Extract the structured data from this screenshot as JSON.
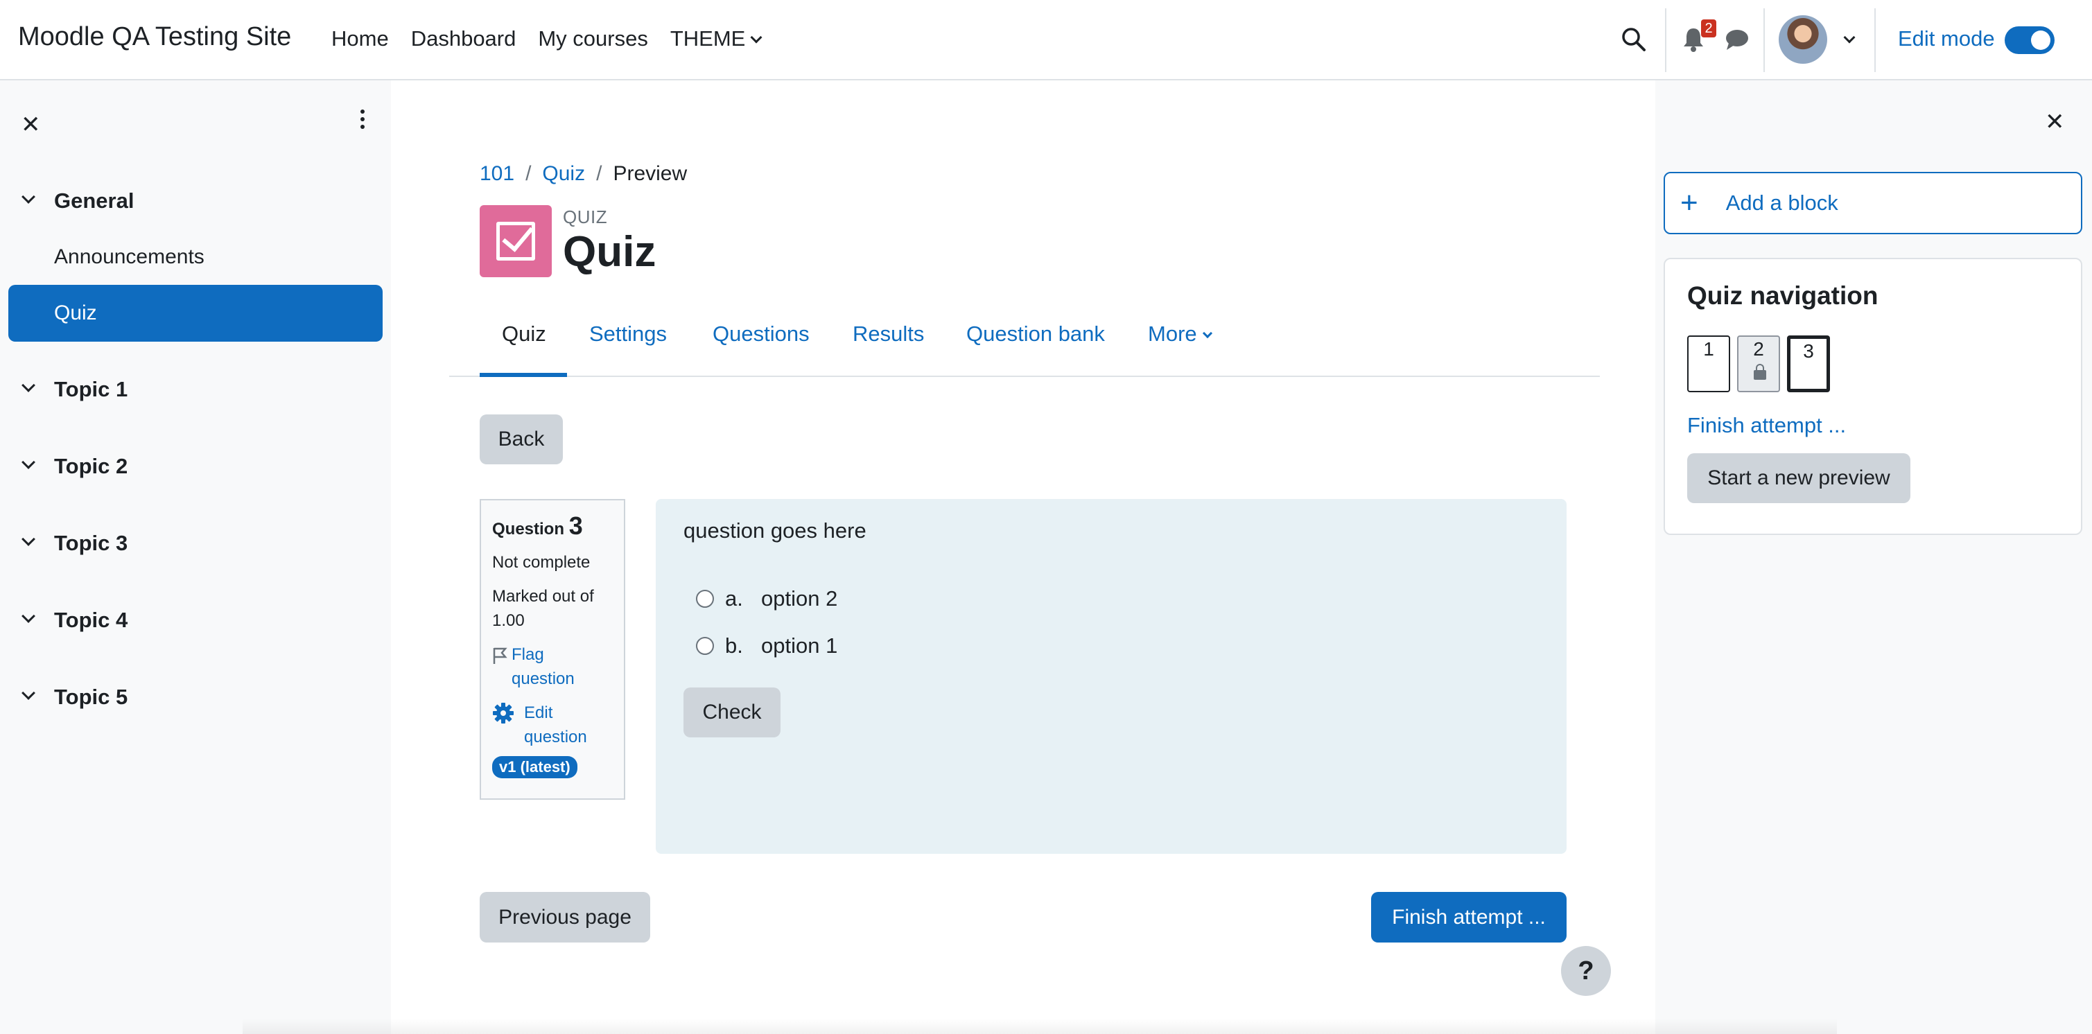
{
  "site": {
    "name": "Moodle QA Testing Site"
  },
  "primary_nav": [
    {
      "label": "Home"
    },
    {
      "label": "Dashboard"
    },
    {
      "label": "My courses"
    },
    {
      "label": "THEME"
    }
  ],
  "header": {
    "notification_count": "2",
    "edit_mode_label": "Edit mode",
    "edit_mode_on": true
  },
  "course_index": {
    "sections": [
      {
        "name": "General",
        "items": [
          {
            "label": "Announcements"
          },
          {
            "label": "Quiz",
            "active": true
          }
        ]
      },
      {
        "name": "Topic 1"
      },
      {
        "name": "Topic 2"
      },
      {
        "name": "Topic 3"
      },
      {
        "name": "Topic 4"
      },
      {
        "name": "Topic 5"
      }
    ]
  },
  "breadcrumb": [
    "101",
    "Quiz",
    "Preview"
  ],
  "page": {
    "pretitle": "QUIZ",
    "title": "Quiz"
  },
  "tabs": [
    {
      "label": "Quiz",
      "active": true
    },
    {
      "label": "Settings"
    },
    {
      "label": "Questions"
    },
    {
      "label": "Results"
    },
    {
      "label": "Question bank"
    },
    {
      "label": "More"
    }
  ],
  "back_button": "Back",
  "question": {
    "label": "Question",
    "number": "3",
    "state": "Not complete",
    "marked_out_of": "Marked out of 1.00",
    "flag_label": "Flag question",
    "edit_label": "Edit question",
    "version_badge": "v1 (latest)",
    "text": "question goes here",
    "options": [
      {
        "letter": "a.",
        "text": "option 2"
      },
      {
        "letter": "b.",
        "text": "option 1"
      }
    ],
    "check_button": "Check"
  },
  "footer_nav": {
    "previous": "Previous page",
    "finish": "Finish attempt ..."
  },
  "help_button": "?",
  "blocks": {
    "add_block": "Add a block",
    "quiz_navigation": {
      "title": "Quiz navigation",
      "questions": [
        {
          "number": "1",
          "state": "normal"
        },
        {
          "number": "2",
          "state": "locked"
        },
        {
          "number": "3",
          "state": "current"
        }
      ],
      "finish_link": "Finish attempt ...",
      "new_preview": "Start a new preview"
    }
  },
  "colors": {
    "primary": "#0f6cbf",
    "quiz_icon": "#e06b9a",
    "question_bg": "#e7f1f5",
    "badge": "#ca3120"
  }
}
